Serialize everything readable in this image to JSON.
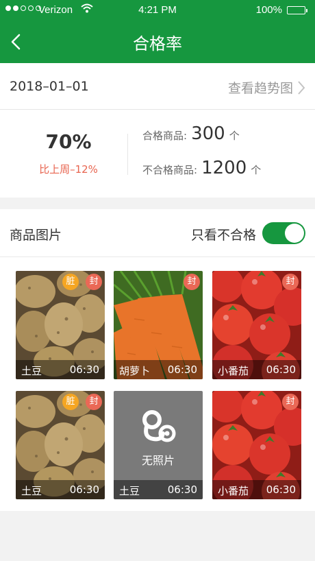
{
  "status_bar": {
    "carrier": "Verizon",
    "time": "4:21 PM",
    "battery": "100%"
  },
  "nav": {
    "title": "合格率"
  },
  "date_row": {
    "date": "2018–01–01",
    "trend_link": "查看趋势图"
  },
  "stats": {
    "rate": "70%",
    "compare": "比上周–12%",
    "qualified_label": "合格商品:",
    "qualified_value": "300",
    "qualified_unit": "个",
    "unqualified_label": "不合格商品:",
    "unqualified_value": "1200",
    "unqualified_unit": "个"
  },
  "gallery": {
    "title": "商品图片",
    "filter_label": "只看不合格",
    "filter_on": true,
    "items": [
      {
        "name": "土豆",
        "time": "06:30",
        "badges": [
          "脏",
          "封"
        ],
        "photo": "potato"
      },
      {
        "name": "胡萝卜",
        "time": "06:30",
        "badges": [
          "封"
        ],
        "photo": "carrot"
      },
      {
        "name": "小番茄",
        "time": "06:30",
        "badges": [
          "封"
        ],
        "photo": "tomato"
      },
      {
        "name": "土豆",
        "time": "06:30",
        "badges": [
          "脏",
          "封"
        ],
        "photo": "potato"
      },
      {
        "name": "土豆",
        "time": "06:30",
        "badges": [],
        "photo": "none",
        "no_photo_text": "无照片"
      },
      {
        "name": "小番茄",
        "time": "06:30",
        "badges": [
          "封"
        ],
        "photo": "tomato"
      }
    ]
  },
  "colors": {
    "brand": "#16973f",
    "dirty_badge": "#f5a623",
    "sealed_badge": "#ea6856",
    "compare_text": "#e8644f"
  }
}
